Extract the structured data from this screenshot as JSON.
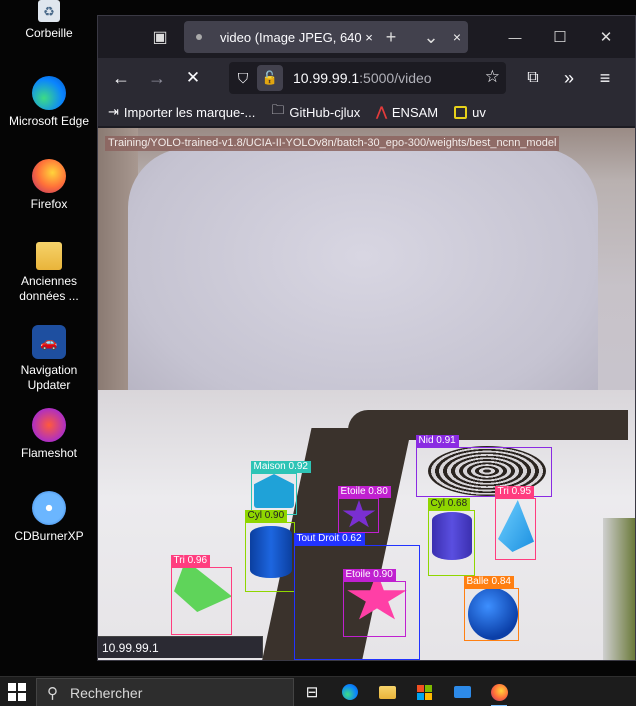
{
  "desktop": {
    "icons": [
      {
        "label": "Corbeille",
        "icon": "recycle-bin-icon"
      },
      {
        "label": "Microsoft Edge",
        "icon": "edge-icon"
      },
      {
        "label": "Firefox",
        "icon": "firefox-icon"
      },
      {
        "label": "Anciennes données ...",
        "icon": "folder-icon"
      },
      {
        "label": "Navigation Updater",
        "icon": "navigation-updater-icon"
      },
      {
        "label": "Flameshot",
        "icon": "flameshot-icon"
      },
      {
        "label": "CDBurnerXP",
        "icon": "cdburnerxp-icon"
      }
    ]
  },
  "browser": {
    "tab": {
      "title": "video (Image JPEG, 640 ×",
      "close": "×"
    },
    "titlebar": {
      "new_tab": "+",
      "list_tabs": "⌄",
      "minimize": "—",
      "maximize": "☐",
      "close": "✕"
    },
    "nav": {
      "back": "←",
      "forward": "→",
      "stop": "✕",
      "url_host": "10.99.99.1",
      "url_rest": ":5000/video"
    },
    "bookmarks": [
      {
        "label": "Importer les marque-...",
        "icon": "import-icon"
      },
      {
        "label": "GitHub-cjlux",
        "icon": "folder-icon"
      },
      {
        "label": "ENSAM",
        "icon": "ensam-icon"
      },
      {
        "label": "uv",
        "icon": "uv-icon"
      }
    ],
    "status_url": "10.99.99.1"
  },
  "video": {
    "model_caption": "Training/YOLO-trained-v1.8/UCIA-II-YOLOv8n/batch-30_epo-300/weights/best_ncnn_model",
    "detections": [
      {
        "label": "Nid  0.91",
        "color": "#8a2be2"
      },
      {
        "label": "Maison 0.92",
        "color": "#2ec4b6"
      },
      {
        "label": "Etoile 0.80",
        "color": "#c020d0"
      },
      {
        "label": "Cyl  0.68",
        "color": "#8fd600"
      },
      {
        "label": "Tri  0.95",
        "color": "#ff3d7f"
      },
      {
        "label": "Cyl  0.90",
        "color": "#8fd600"
      },
      {
        "label": "Tout Droit 0.62",
        "color": "#2233ff"
      },
      {
        "label": "Tri  0.96",
        "color": "#ff3d7f"
      },
      {
        "label": "Etoile 0.90",
        "color": "#c020d0"
      },
      {
        "label": "Balle 0.84",
        "color": "#ff7f11"
      }
    ]
  },
  "taskbar": {
    "search_placeholder": "Rechercher",
    "apps": [
      "task-view-icon",
      "edge-icon",
      "file-explorer-icon",
      "store-icon",
      "mail-icon",
      "firefox-icon"
    ]
  }
}
